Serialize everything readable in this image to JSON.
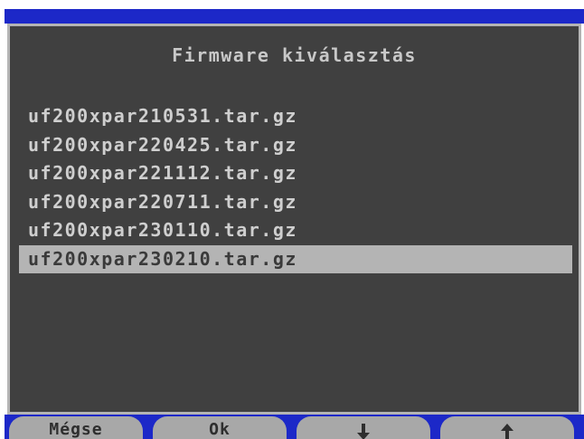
{
  "screen": {
    "title": "Firmware kiválasztás"
  },
  "files": [
    {
      "name": "uf200xpar210531.tar.gz",
      "selected": false
    },
    {
      "name": "uf200xpar220425.tar.gz",
      "selected": false
    },
    {
      "name": "uf200xpar221112.tar.gz",
      "selected": false
    },
    {
      "name": "uf200xpar220711.tar.gz",
      "selected": false
    },
    {
      "name": "uf200xpar230110.tar.gz",
      "selected": false
    },
    {
      "name": "uf200xpar230210.tar.gz",
      "selected": true
    }
  ],
  "softkeys": {
    "cancel_label": "Mégse",
    "ok_label": "Ok",
    "down_icon": "arrow-down-icon",
    "up_icon": "arrow-up-icon"
  },
  "colors": {
    "frame_blue": "#1c28c8",
    "screen_bg": "#404040",
    "selection_bg": "#b4b4b4"
  }
}
